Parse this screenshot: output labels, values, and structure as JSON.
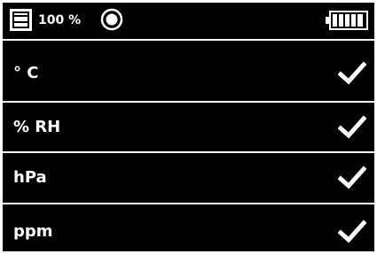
{
  "status": {
    "memory_icon": "memory-card-icon",
    "level_text": "100 %",
    "record_icon": "record-icon",
    "battery_icon": "battery-full-icon"
  },
  "units": [
    {
      "label": "° C",
      "selected": true,
      "icon": "checkmark-icon"
    },
    {
      "label": "% RH",
      "selected": true,
      "icon": "checkmark-icon"
    },
    {
      "label": "hPa",
      "selected": true,
      "icon": "checkmark-icon"
    },
    {
      "label": "ppm",
      "selected": true,
      "icon": "checkmark-icon"
    }
  ],
  "colors": {
    "background": "#000000",
    "foreground": "#ffffff"
  }
}
